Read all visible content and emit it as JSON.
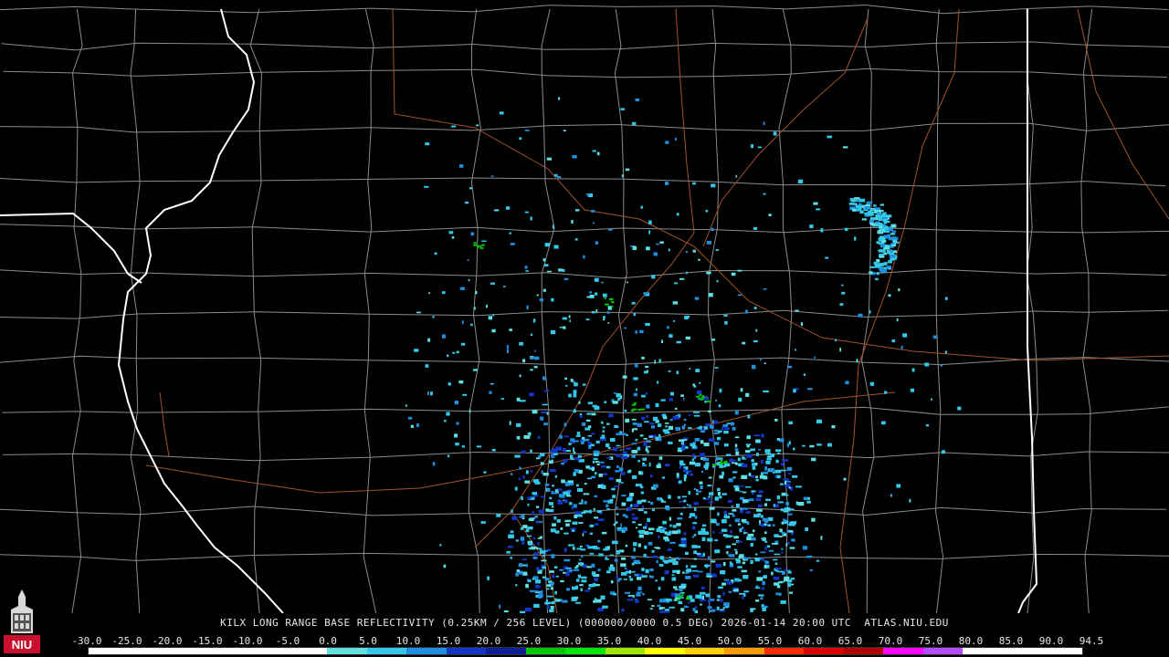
{
  "map": {
    "caption": "KILX LONG RANGE BASE REFLECTIVITY (0.25KM / 256 LEVEL) (000000/0000 0.5 DEG) 2026-01-14 20:00 UTC  ATLAS.NIU.EDU",
    "radar_site": "KILX",
    "product": "LONG RANGE BASE REFLECTIVITY",
    "colors": {
      "background": "#000000",
      "state_border": "#ffffff",
      "county_border": "#8a8a8a",
      "highway": "#a0522d"
    }
  },
  "colorbar": {
    "labels": [
      "-30.0",
      "-25.0",
      "-20.0",
      "-15.0",
      "-10.0",
      "-5.0",
      "0.0",
      "5.0",
      "10.0",
      "15.0",
      "20.0",
      "25.0",
      "30.0",
      "35.0",
      "40.0",
      "45.0",
      "50.0",
      "55.0",
      "60.0",
      "65.0",
      "70.0",
      "75.0",
      "80.0",
      "85.0",
      "90.0",
      "94.5"
    ],
    "colors": [
      "#ffffff",
      "#ffffff",
      "#ffffff",
      "#ffffff",
      "#ffffff",
      "#ffffff",
      "#5fe0e0",
      "#33c8e8",
      "#1f8fe0",
      "#1436c8",
      "#0f1e9a",
      "#00c800",
      "#00e600",
      "#a0e600",
      "#ffff00",
      "#ffd000",
      "#ff9a00",
      "#ff2a00",
      "#d80000",
      "#b00000",
      "#ff00ff",
      "#b44cff",
      "#ffffff",
      "#ffffff",
      "#ffffff"
    ]
  },
  "logo": {
    "text": "NIU",
    "icon": "niu-tower-logo-icon",
    "color": "#c8102e"
  }
}
